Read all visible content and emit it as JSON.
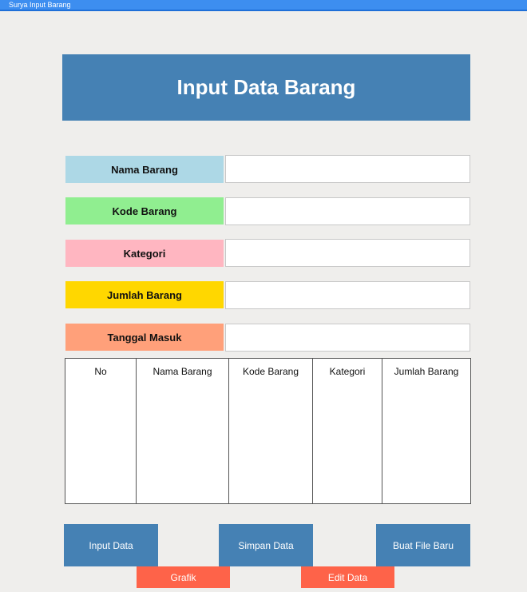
{
  "window": {
    "title": "Surya Input Barang"
  },
  "header": {
    "title": "Input Data Barang"
  },
  "form": {
    "fields": [
      {
        "label": "Nama Barang",
        "color": "#add8e6",
        "value": ""
      },
      {
        "label": "Kode Barang",
        "color": "#90ee90",
        "value": ""
      },
      {
        "label": "Kategori",
        "color": "#ffb6c1",
        "value": ""
      },
      {
        "label": "Jumlah Barang",
        "color": "#ffd700",
        "value": ""
      },
      {
        "label": "Tanggal Masuk",
        "color": "#ffa07a",
        "value": ""
      }
    ]
  },
  "table": {
    "columns": [
      "No",
      "Nama Barang",
      "Kode Barang",
      "Kategori",
      "Jumlah Barang"
    ],
    "rows": []
  },
  "buttons": {
    "input_data": "Input Data",
    "simpan_data": "Simpan Data",
    "buat_file_baru": "Buat File Baru",
    "grafik": "Grafik",
    "edit_data": "Edit Data"
  },
  "colors": {
    "primary": "#4581b4",
    "secondary": "#fe6349",
    "titlebar": "#3d8ef0"
  }
}
